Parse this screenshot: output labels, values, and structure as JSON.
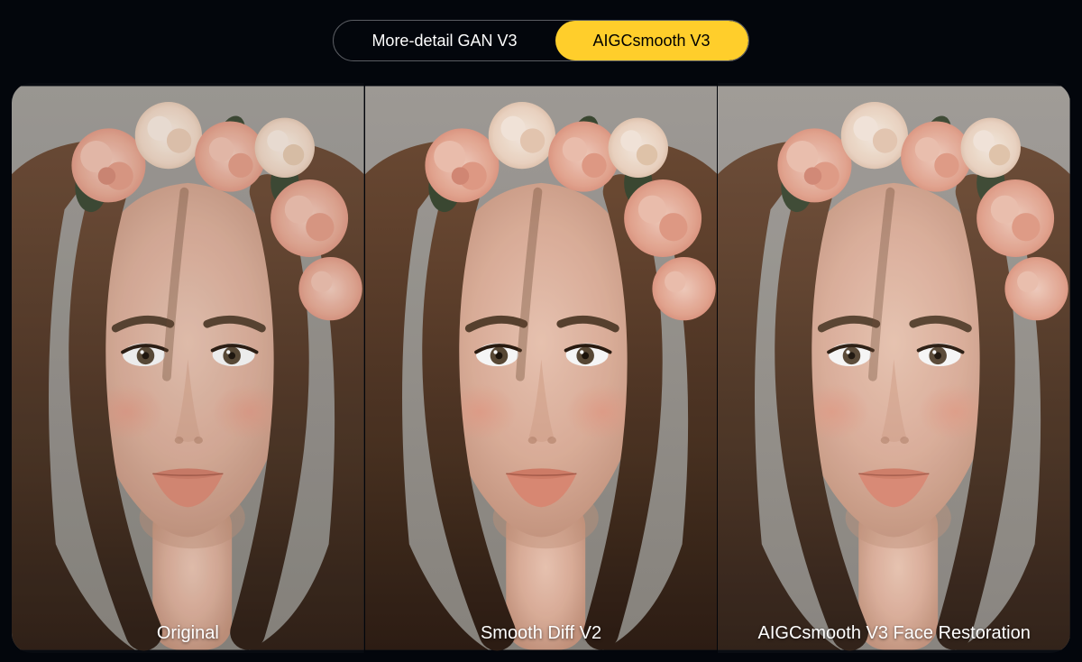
{
  "tabs": [
    {
      "id": "gan",
      "label": "More-detail GAN V3",
      "active": false
    },
    {
      "id": "smooth",
      "label": "AIGCsmooth V3",
      "active": true
    }
  ],
  "panels": [
    {
      "id": "original",
      "caption": "Original"
    },
    {
      "id": "smoothv2",
      "caption": "Smooth Diff V2"
    },
    {
      "id": "aigcv3",
      "caption": "AIGCsmooth V3 Face Restoration"
    }
  ],
  "colors": {
    "background": "#03060c",
    "pill_active": "#ffce2b"
  }
}
